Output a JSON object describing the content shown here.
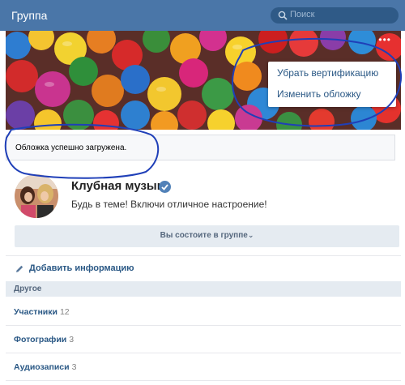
{
  "header": {
    "title": "Группа",
    "search_placeholder": "Поиск"
  },
  "cover": {
    "more_glyph": "•••",
    "menu": {
      "items": [
        "Убрать вертификацию",
        "Изменить обложку"
      ]
    }
  },
  "notice": {
    "text": "Обложка успешно загружена."
  },
  "group": {
    "name": "Клубная музыка",
    "status": "Будь в теме! Включи отличное настроение!",
    "member_button": "Вы состоите в группе"
  },
  "actions": {
    "add_info": "Добавить информацию"
  },
  "section": {
    "title": "Другое"
  },
  "rows": [
    {
      "label": "Участники",
      "count": "12"
    },
    {
      "label": "Фотографии",
      "count": "3"
    },
    {
      "label": "Аудиозаписи",
      "count": "3"
    }
  ],
  "colors": {
    "header": "#4a76a8",
    "link": "#2a5885",
    "annotation": "#1f3fb8"
  }
}
